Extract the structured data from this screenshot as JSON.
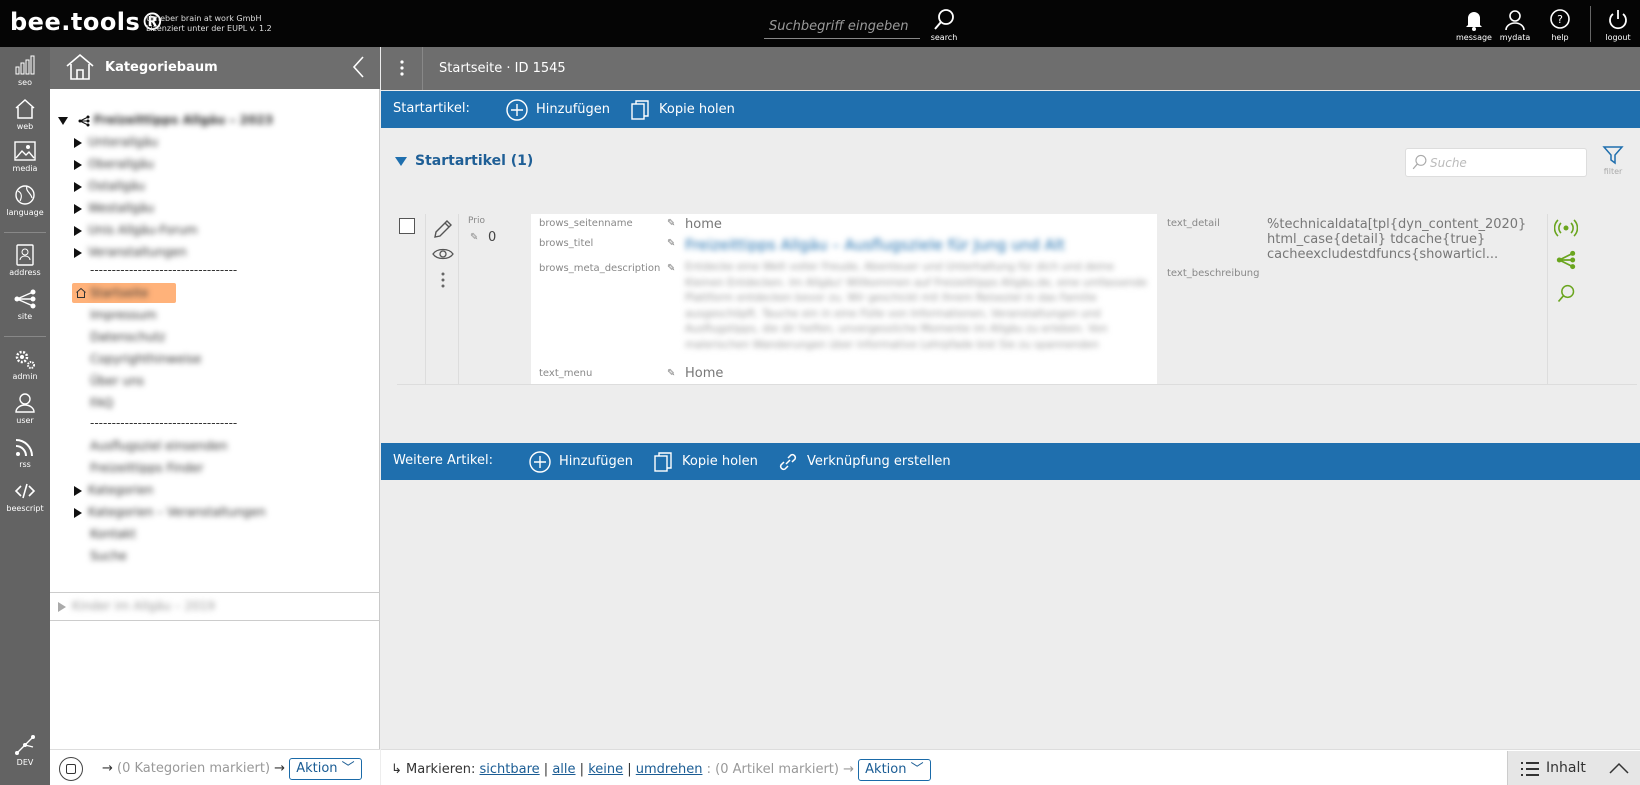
{
  "app": {
    "brand": "bee.tools®",
    "license_line1": "Urheber brain at work GmbH",
    "license_line2": "Lizenziert unter der EUPL v. 1.2"
  },
  "topbar": {
    "search_placeholder": "Suchbegriff eingeben",
    "search_label": "search",
    "buttons": [
      {
        "label": "message"
      },
      {
        "label": "mydata"
      },
      {
        "label": "help"
      },
      {
        "label": "logout"
      }
    ]
  },
  "leftnav": {
    "items": [
      {
        "label": "seo"
      },
      {
        "label": "web"
      },
      {
        "label": "media"
      },
      {
        "label": "language"
      },
      {
        "label": "address"
      },
      {
        "label": "site"
      },
      {
        "label": "admin"
      },
      {
        "label": "user"
      },
      {
        "label": "rss"
      },
      {
        "label": "beescript"
      },
      {
        "label": "DEV"
      }
    ]
  },
  "tree": {
    "title": "Kategoriebaum",
    "root": "Freizeittipps Allgäu – 2023",
    "children": [
      "Unterallgäu",
      "Oberallgäu",
      "Ostallgäu",
      "Westallgäu",
      "Unis Allgäu-Forum",
      "Veranstaltungen"
    ],
    "separator": "----------------------------------",
    "selected": "Startseite",
    "pages": [
      "Impressum",
      "Datenschutz",
      "Copyrighthinweise",
      "Über uns",
      "FAQ"
    ],
    "more": [
      "Ausflugsziel einsenden",
      "Freizeittipps Finder",
      "Kategorien",
      "Kategorien – Veranstaltungen",
      "Kontakt",
      "Suche"
    ],
    "second_root": "Kinder im Allgäu – 2019",
    "footer": {
      "marked": "(0 Kategorien markiert)",
      "action": "Aktion"
    }
  },
  "main": {
    "title": "Startseite · ID 1545",
    "bar1": {
      "lead": "Startartikel:",
      "add": "Hinzufügen",
      "copy": "Kopie holen"
    },
    "section": {
      "title": "Startartikel (1)",
      "search_placeholder": "Suche",
      "filter_label": "filter"
    },
    "article": {
      "prio_label": "Prio",
      "prio_value": "0",
      "fields": [
        {
          "key": "brows_seitenname",
          "value": "home"
        },
        {
          "key": "brows_titel",
          "value": "Freizeittipps Allgäu – Ausflugsziele für Jung und Alt"
        },
        {
          "key": "brows_meta_description",
          "value": "Entdecke eine Welt voller Freude, Abenteuer und Unterhaltung für dich und deine Kleinen Entdecken. Im Allgäu! Willkommen auf Freizeittipps Allgäu.de, eine umfassende Plattform entdecken bevor zu. Wir geschickt mit Ihrem Reiseziel in das Familie ausgeschöpft. Tauche ein in eine Fülle von Informationen, Veranstaltungen und Ausflugstipps, die dir helfen, unvergessliche Momente im Allgäu zu erleben. Von malerischen Wanderungen über informative Lehrpfade bist Sie zu spannenden Freizeitparks."
        },
        {
          "key": "text_menu",
          "value": "Home"
        }
      ],
      "right": [
        {
          "key": "text_detail",
          "value": "%technicaldata[tpl{dyn_content_2020} html_case{detail} tdcache{true} cacheexcludestdfuncs{showarticl..."
        },
        {
          "key": "text_beschreibung",
          "value": ""
        }
      ]
    },
    "bar2": {
      "lead": "Weitere Artikel:",
      "add": "Hinzufügen",
      "copy": "Kopie holen",
      "link": "Verknüpfung erstellen"
    },
    "footer": {
      "prefix": "↳ Markieren:",
      "visible": "sichtbare",
      "all": "alle",
      "none": "keine",
      "invert": "umdrehen",
      "marked": ": (0 Artikel markiert) →",
      "action": "Aktion",
      "inhalt": "Inhalt"
    }
  },
  "colors": {
    "accent": "#1f6fae",
    "highlight": "#ffb27a",
    "green": "#6aa51e"
  }
}
